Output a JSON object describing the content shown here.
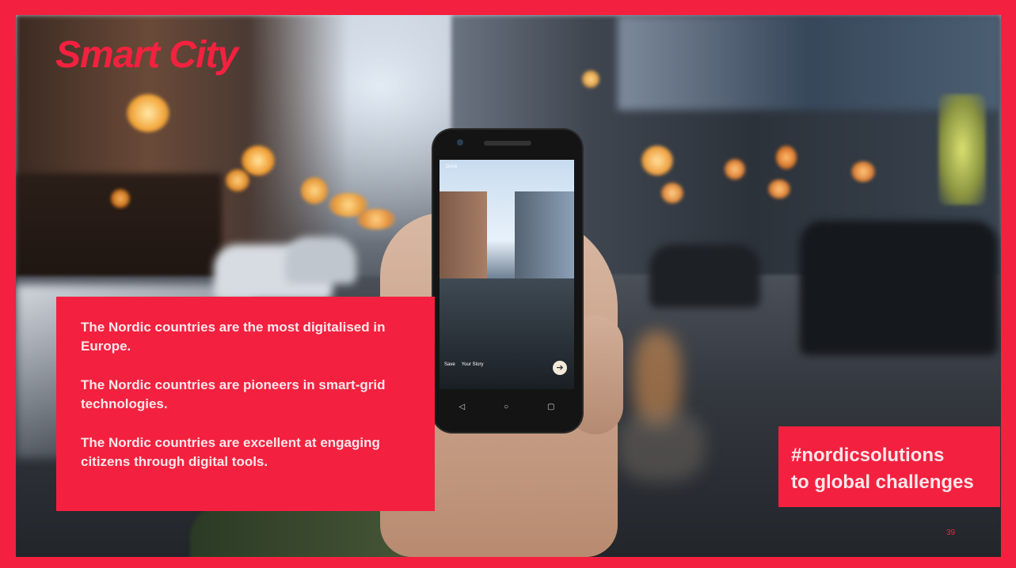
{
  "slide": {
    "title": "Smart City",
    "facts": [
      "The Nordic countries are the most digitalised in Europe.",
      "The Nordic countries are pioneers in smart-grid technologies.",
      "The Nordic countries are excellent at engaging citizens through digital tools."
    ],
    "tagline": {
      "line1": "#nordicsolutions",
      "line2": "to global challenges"
    },
    "page_number": "39"
  },
  "phone_screen": {
    "top_left_label": "Done",
    "save_label": "Save",
    "story_label": "Your Story",
    "next_icon": "arrow-right-icon",
    "nav_icons": [
      "back-icon",
      "home-icon",
      "recent-apps-icon"
    ],
    "nav_glyphs": [
      "◁",
      "○",
      "▢"
    ],
    "next_glyph": "➔"
  },
  "colors": {
    "accent": "#f3213f",
    "box_text": "#fde7ea"
  }
}
